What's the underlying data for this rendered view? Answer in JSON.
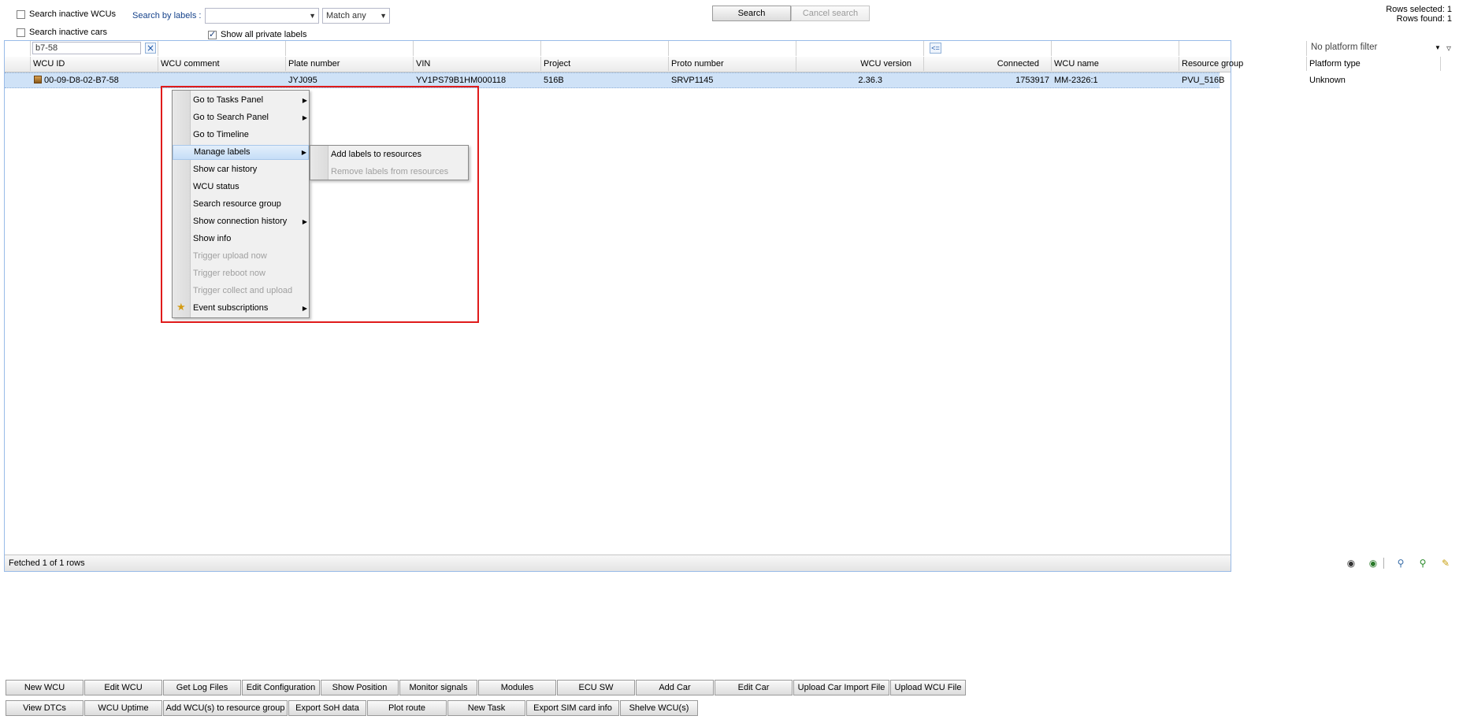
{
  "toolbar": {
    "search_inactive_wcus": "Search inactive WCUs",
    "search_inactive_cars": "Search inactive cars",
    "search_by_labels": "Search by labels :",
    "labels_select_value": "",
    "match_select_value": "Match any",
    "show_all_private_labels": "Show all private labels",
    "search_button": "Search",
    "cancel_search_button": "Cancel search",
    "rows_selected": "Rows selected: 1",
    "rows_found": "Rows found: 1"
  },
  "filters": {
    "wcu_id_filter": "b7-58",
    "platform_filter": "No platform filter",
    "connected_operator": "<="
  },
  "columns": [
    "WCU ID",
    "WCU comment",
    "Plate number",
    "VIN",
    "Project",
    "Proto number",
    "WCU version",
    "Connected",
    "WCU name",
    "Resource group",
    "Platform type"
  ],
  "row": {
    "wcu_id": "00-09-D8-02-B7-58",
    "wcu_comment": "",
    "plate_number": "JYJ095",
    "vin": "YV1PS79B1HM000118",
    "project": "516B",
    "proto_number": "SRVP1145",
    "wcu_version": "2.36.3",
    "connected": "1753917",
    "wcu_name": "MM-2326:1",
    "resource_group": "PVU_516B",
    "platform_type": "Unknown"
  },
  "context_menu": [
    {
      "label": "Go to Tasks Panel",
      "submenu": true,
      "disabled": false
    },
    {
      "label": "Go to Search Panel",
      "submenu": true,
      "disabled": false
    },
    {
      "label": "Go to Timeline",
      "submenu": false,
      "disabled": false
    },
    {
      "label": "Manage labels",
      "submenu": true,
      "disabled": false
    },
    {
      "label": "Show car history",
      "submenu": false,
      "disabled": false
    },
    {
      "label": "WCU status",
      "submenu": false,
      "disabled": false
    },
    {
      "label": "Search resource group",
      "submenu": false,
      "disabled": false
    },
    {
      "label": "Show connection history",
      "submenu": true,
      "disabled": false
    },
    {
      "label": "Show info",
      "submenu": false,
      "disabled": false
    },
    {
      "label": "Trigger upload now",
      "submenu": false,
      "disabled": true
    },
    {
      "label": "Trigger reboot now",
      "submenu": false,
      "disabled": true
    },
    {
      "label": "Trigger collect and upload",
      "submenu": false,
      "disabled": true
    },
    {
      "label": "Event subscriptions",
      "submenu": true,
      "disabled": false
    }
  ],
  "labels_submenu": [
    {
      "label": "Add labels to resources",
      "disabled": false
    },
    {
      "label": "Remove labels from resources",
      "disabled": true
    }
  ],
  "status": {
    "fetched": "Fetched 1 of 1 rows"
  },
  "status_icons": [
    "binoculars-icon",
    "binoculars-add-icon",
    "zoom-out-icon",
    "zoom-in-icon",
    "clear-brush-icon"
  ],
  "buttons_row1": [
    "New WCU",
    "Edit WCU",
    "Get Log Files",
    "Edit Configuration",
    "Show Position",
    "Monitor signals",
    "Modules",
    "ECU SW",
    "Add Car",
    "Edit Car",
    "Upload Car Import File",
    "Upload WCU File"
  ],
  "buttons_row2": [
    "View DTCs",
    "WCU Uptime",
    "Add WCU(s) to resource group",
    "Export SoH data",
    "Plot route",
    "New Task",
    "Export SIM card info",
    "Shelve WCU(s)"
  ],
  "colors": {
    "selection": "#cfe2f7",
    "highlight_box": "#e01b1b",
    "link_label": "#15428b"
  }
}
